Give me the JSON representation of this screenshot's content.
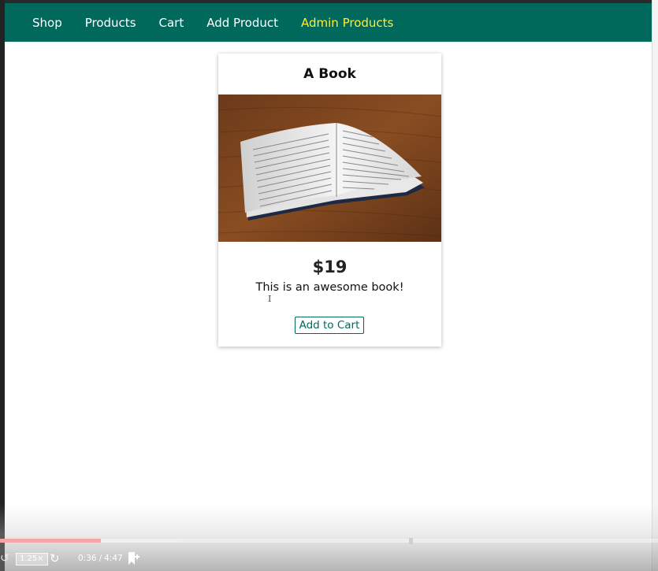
{
  "nav": {
    "items": [
      {
        "label": "Shop"
      },
      {
        "label": "Products"
      },
      {
        "label": "Cart"
      },
      {
        "label": "Add Product"
      },
      {
        "label": "Admin Products"
      }
    ],
    "active_label": "Admin Products"
  },
  "product": {
    "title": "A Book",
    "price": "$19",
    "description": "This is an awesome book!",
    "add_to_cart_label": "Add to Cart"
  },
  "player": {
    "speed": "1.25×",
    "time_current": "0:36",
    "time_separator": "/",
    "time_total": "4:47",
    "played_fraction": 0.153,
    "buffered_fraction": 0.275
  },
  "colors": {
    "navbar": "#00695c",
    "nav_active": "#ffeb3b",
    "accent": "#00695c"
  }
}
